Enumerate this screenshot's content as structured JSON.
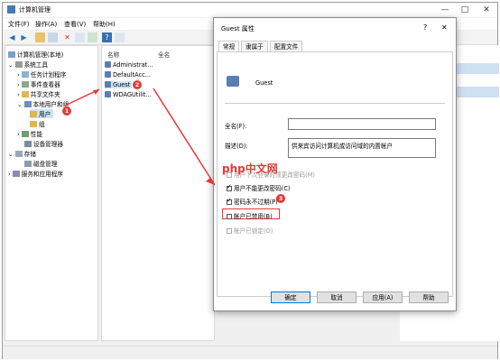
{
  "window": {
    "title": "计算机管理",
    "minimize": "—",
    "maximize": "□",
    "close": "✕"
  },
  "menu": [
    "文件(F)",
    "操作(A)",
    "查看(V)",
    "帮助(H)"
  ],
  "tree": {
    "root": "计算机管理(本地)",
    "system_tools": "系统工具",
    "task_scheduler": "任务计划程序",
    "event_viewer": "事件查看器",
    "shared_folders": "共享文件夹",
    "local_users": "本地用户和组",
    "users": "用户",
    "groups": "组",
    "performance": "性能",
    "device_manager": "设备管理器",
    "storage": "存储",
    "disk_mgmt": "磁盘管理",
    "services": "服务和应用程序"
  },
  "list": {
    "col_name": "名称",
    "col_fullname": "全名",
    "rows": [
      "Administrat...",
      "DefaultAcc...",
      "Guest",
      "WDAGUtilit..."
    ]
  },
  "dialog": {
    "title": "Guest 属性",
    "help": "?",
    "close": "✕",
    "tabs": [
      "常规",
      "隶属于",
      "配置文件"
    ],
    "username": "Guest",
    "fullname_label": "全名(F):",
    "fullname_value": "",
    "desc_label": "描述(D):",
    "desc_value": "供来宾访问计算机或访问域的内置帐户",
    "opt_change_next": "用户下次登录时须更改密码(M)",
    "opt_cannot_change": "用户不能更改密码(C)",
    "opt_never_expire": "密码永不过期(P)",
    "opt_disabled": "帐户已禁用(B)",
    "opt_locked": "帐户已锁定(O)",
    "ok": "确定",
    "cancel": "取消",
    "apply": "应用(A)",
    "helpbtn": "帮助"
  },
  "annotations": {
    "b1": "1",
    "b2": "2",
    "b3": "3",
    "watermark": "php中文网"
  },
  "colors": {
    "accent": "#e53935",
    "selection": "#cce4f7"
  }
}
